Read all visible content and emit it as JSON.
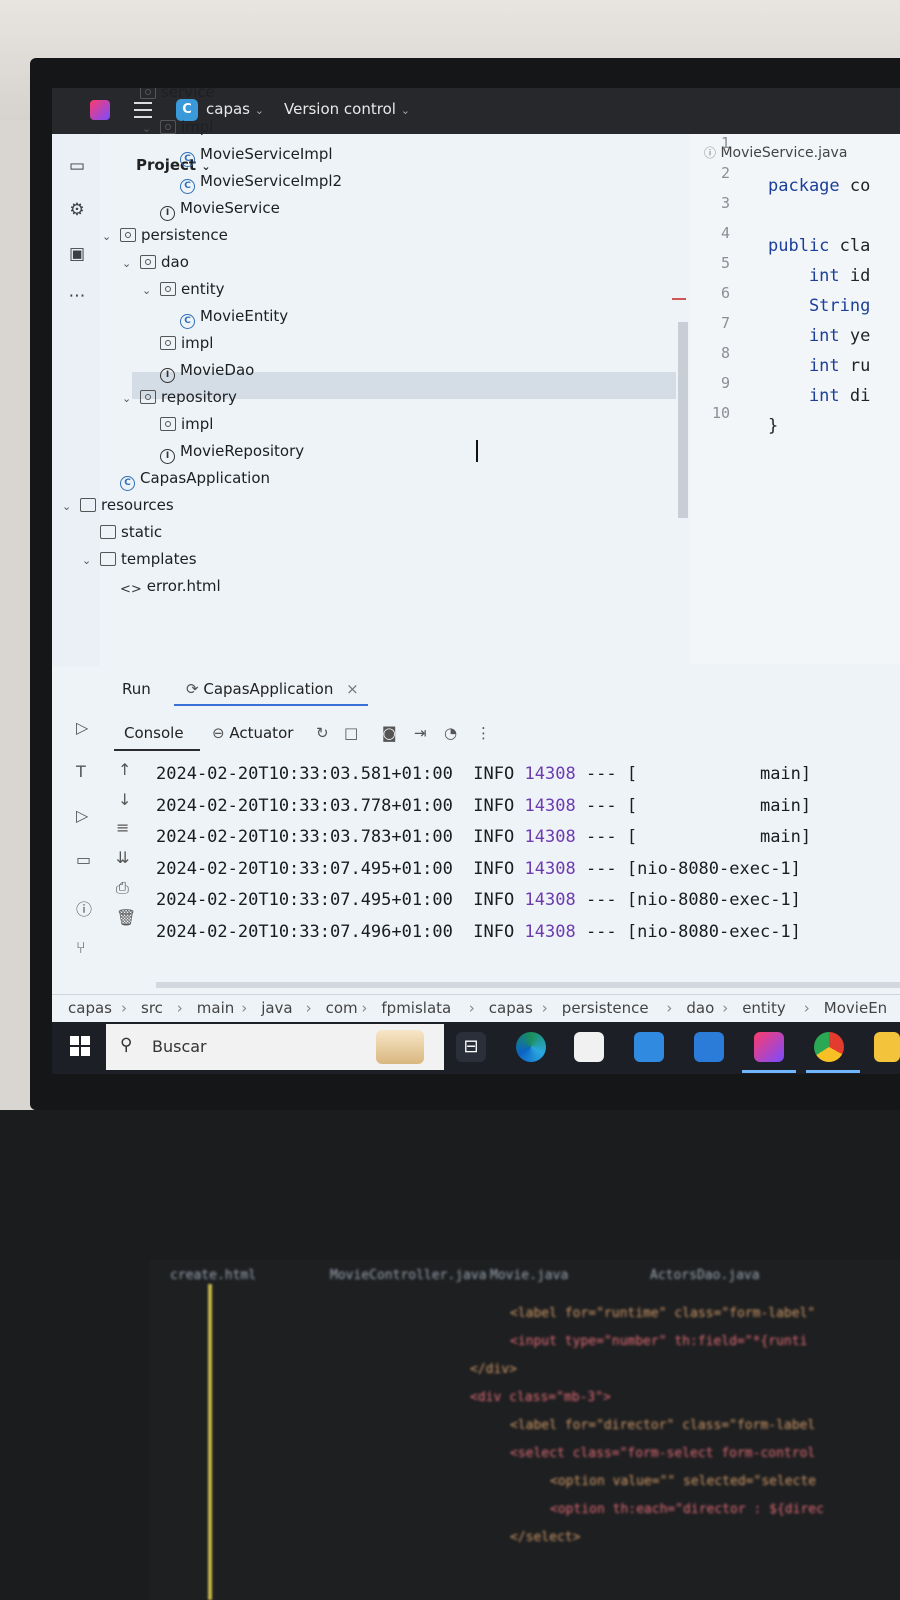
{
  "window": {
    "project_badge": "C",
    "project_name": "capas",
    "vcs_menu": "Version control"
  },
  "project_panel": {
    "title": "Project"
  },
  "tree": [
    {
      "label": "service",
      "icon": "package",
      "depth": 7,
      "chev": "",
      "partial": true
    },
    {
      "label": "impl",
      "icon": "package",
      "depth": 8,
      "chev": "v"
    },
    {
      "label": "MovieServiceImpl",
      "icon": "class",
      "depth": 9
    },
    {
      "label": "MovieServiceImpl2",
      "icon": "class",
      "depth": 9
    },
    {
      "label": "MovieService",
      "icon": "interface",
      "depth": 8
    },
    {
      "label": "persistence",
      "icon": "package",
      "depth": 6,
      "chev": "v"
    },
    {
      "label": "dao",
      "icon": "package",
      "depth": 7,
      "chev": "v"
    },
    {
      "label": "entity",
      "icon": "package",
      "depth": 8,
      "chev": "v"
    },
    {
      "label": "MovieEntity",
      "icon": "class",
      "depth": 9,
      "selected": true
    },
    {
      "label": "impl",
      "icon": "package",
      "depth": 8
    },
    {
      "label": "MovieDao",
      "icon": "interface",
      "depth": 8
    },
    {
      "label": "repository",
      "icon": "package",
      "depth": 7,
      "chev": "v"
    },
    {
      "label": "impl",
      "icon": "package",
      "depth": 8
    },
    {
      "label": "MovieRepository",
      "icon": "interface",
      "depth": 8
    },
    {
      "label": "CapasApplication",
      "icon": "app",
      "depth": 6
    },
    {
      "label": "resources",
      "icon": "folder",
      "depth": 4,
      "chev": "v"
    },
    {
      "label": "static",
      "icon": "folder",
      "depth": 5
    },
    {
      "label": "templates",
      "icon": "folder",
      "depth": 5,
      "chev": "v"
    },
    {
      "label": "error.html",
      "icon": "html",
      "depth": 6
    }
  ],
  "editor": {
    "tab": "MovieService.java",
    "line_numbers": [
      "1",
      "2",
      "3",
      "4",
      "5",
      "6",
      "7",
      "8",
      "9",
      "10"
    ],
    "lines": [
      {
        "kw": "package",
        "rest": " co"
      },
      {
        "kw": "",
        "rest": ""
      },
      {
        "kw": "public",
        "rest": " cla"
      },
      {
        "kw": "    int",
        "rest": " id"
      },
      {
        "kw": "    String",
        "rest": ""
      },
      {
        "kw": "    int",
        "rest": " ye"
      },
      {
        "kw": "    int",
        "rest": " ru"
      },
      {
        "kw": "    int",
        "rest": " di"
      },
      {
        "kw": "",
        "rest": "}"
      },
      {
        "kw": "",
        "rest": ""
      }
    ]
  },
  "run_panel": {
    "run_label": "Run",
    "run_tab": "CapasApplication",
    "console_tab": "Console",
    "actuator_tab": "Actuator"
  },
  "log": [
    {
      "ts": "2024-02-20T10:33:03.581+01:00",
      "level": "INFO",
      "pid": "14308",
      "sep": "---",
      "thread": "[            main]"
    },
    {
      "ts": "2024-02-20T10:33:03.778+01:00",
      "level": "INFO",
      "pid": "14308",
      "sep": "---",
      "thread": "[            main]"
    },
    {
      "ts": "2024-02-20T10:33:03.783+01:00",
      "level": "INFO",
      "pid": "14308",
      "sep": "---",
      "thread": "[            main]"
    },
    {
      "ts": "2024-02-20T10:33:07.495+01:00",
      "level": "INFO",
      "pid": "14308",
      "sep": "---",
      "thread": "[nio-8080-exec-1]"
    },
    {
      "ts": "2024-02-20T10:33:07.495+01:00",
      "level": "INFO",
      "pid": "14308",
      "sep": "---",
      "thread": "[nio-8080-exec-1]"
    },
    {
      "ts": "2024-02-20T10:33:07.496+01:00",
      "level": "INFO",
      "pid": "14308",
      "sep": "---",
      "thread": "[nio-8080-exec-1]"
    }
  ],
  "breadcrumb": [
    "capas",
    "src",
    "main",
    "java",
    "com",
    "fpmislata",
    "capas",
    "persistence",
    "dao",
    "entity",
    "MovieEn"
  ],
  "taskbar": {
    "search_placeholder": "Buscar"
  },
  "background_editor": {
    "tabs": [
      "create.html",
      "MovieController.java",
      "Movie.java",
      "ActorsDao.java"
    ],
    "lines": [
      "<label for=\"runtime\" class=\"form-label\"",
      "<input type=\"number\" th:field=\"*{runti",
      "</div>",
      "<div class=\"mb-3\">",
      "<label for=\"director\" class=\"form-label",
      "<select class=\"form-select form-control",
      "<option value=\"\" selected=\"selecte",
      "<option th:each=\"director : ${direc",
      "</select>"
    ]
  }
}
